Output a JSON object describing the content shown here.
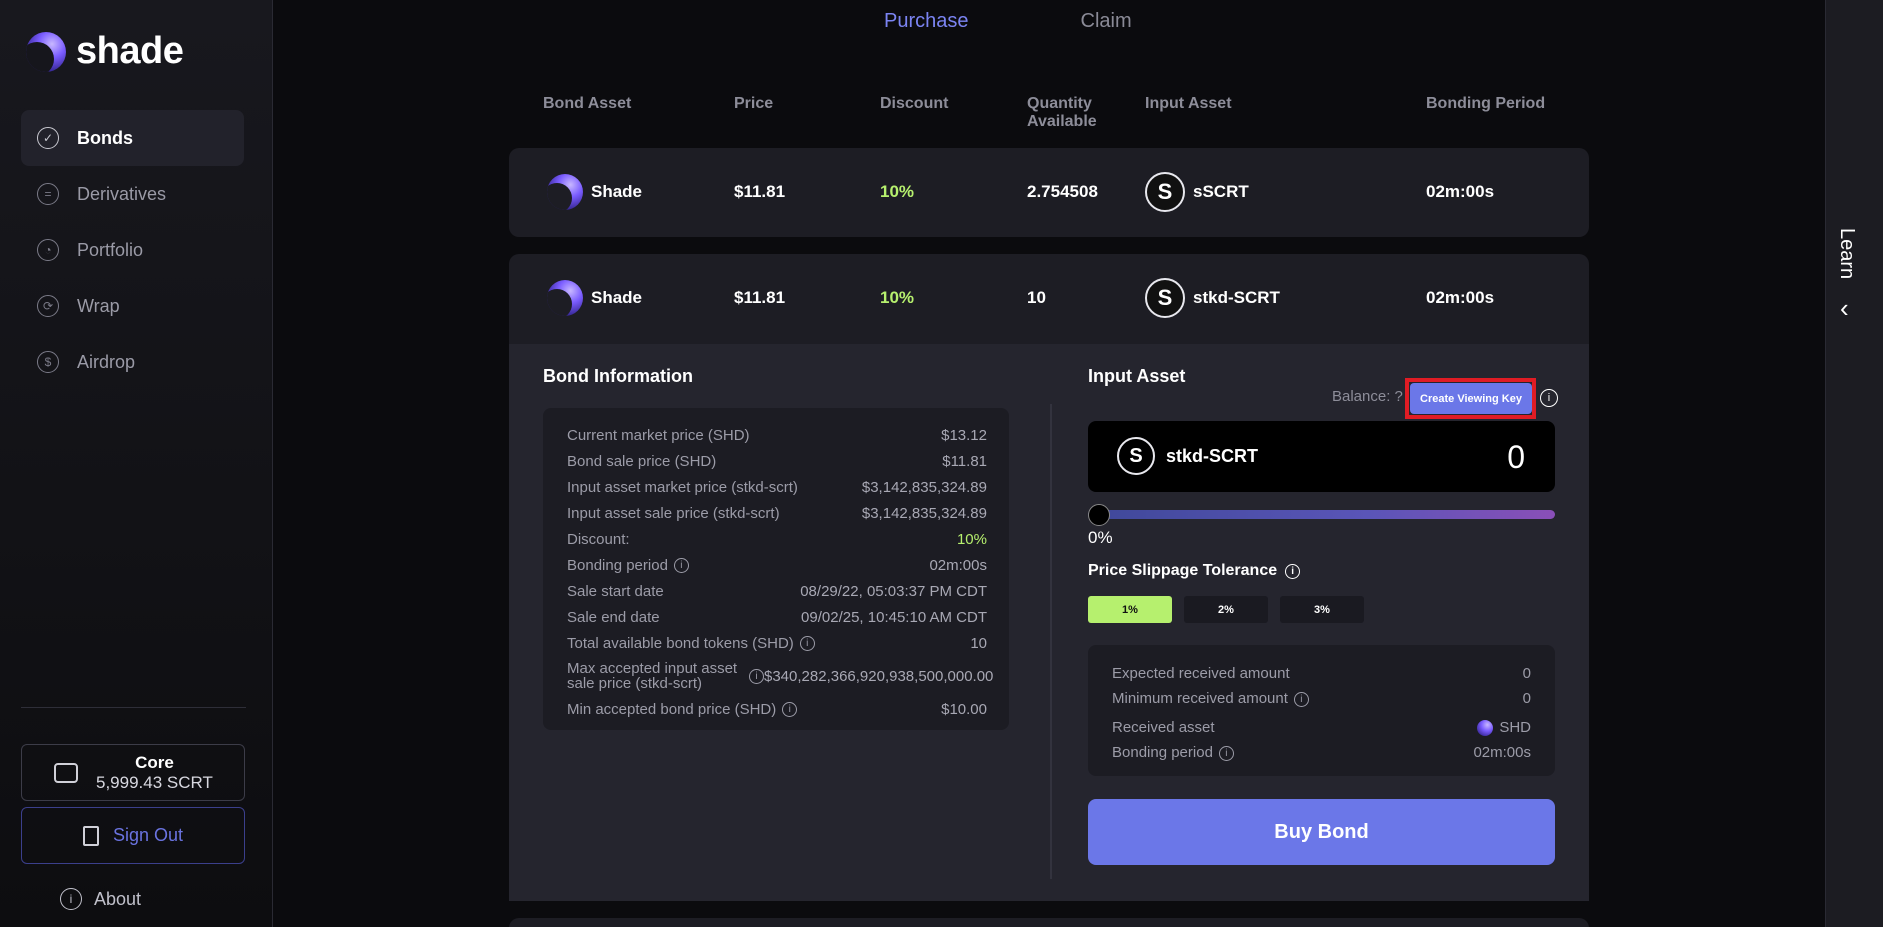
{
  "sidebar": {
    "logo": "shade",
    "nav": [
      {
        "label": "Bonds",
        "icon": "bonds-icon"
      },
      {
        "label": "Derivatives",
        "icon": "derivatives-icon"
      },
      {
        "label": "Portfolio",
        "icon": "portfolio-icon"
      },
      {
        "label": "Wrap",
        "icon": "wrap-icon"
      },
      {
        "label": "Airdrop",
        "icon": "airdrop-icon"
      }
    ],
    "wallet": {
      "title": "Core",
      "balance": "5,999.43 SCRT"
    },
    "sign_out": "Sign Out",
    "about": "About"
  },
  "tabs": {
    "purchase": "Purchase",
    "claim": "Claim"
  },
  "table": {
    "headers": {
      "bond_asset": "Bond Asset",
      "price": "Price",
      "discount": "Discount",
      "quantity_line1": "Quantity",
      "quantity_line2": "Available",
      "input_asset": "Input Asset",
      "bonding_period": "Bonding Period"
    },
    "rows": [
      {
        "bond_asset": "Shade",
        "price": "$11.81",
        "discount": "10%",
        "quantity": "2.754508",
        "input_asset": "sSCRT",
        "bonding_period": "02m:00s"
      },
      {
        "bond_asset": "Shade",
        "price": "$11.81",
        "discount": "10%",
        "quantity": "10",
        "input_asset": "stkd-SCRT",
        "bonding_period": "02m:00s"
      }
    ]
  },
  "bond_info": {
    "title": "Bond Information",
    "rows": [
      {
        "label": "Current market price (SHD)",
        "value": "$13.12"
      },
      {
        "label": "Bond sale price (SHD)",
        "value": "$11.81"
      },
      {
        "label": "Input asset market price (stkd-scrt)",
        "value": "$3,142,835,324.89"
      },
      {
        "label": "Input asset sale price (stkd-scrt)",
        "value": "$3,142,835,324.89"
      },
      {
        "label": "Discount:",
        "value": "10%"
      },
      {
        "label": "Bonding period",
        "value": "02m:00s"
      },
      {
        "label": "Sale start date",
        "value": "08/29/22, 05:03:37 PM CDT"
      },
      {
        "label": "Sale end date",
        "value": "09/02/25, 10:45:10 AM CDT"
      },
      {
        "label": "Total available bond tokens (SHD)",
        "value": "10"
      },
      {
        "label_line1": "Max accepted input asset",
        "label_line2": "sale price (stkd-scrt)",
        "value": "$340,282,366,920,938,500,000.00"
      },
      {
        "label": "Min accepted bond price (SHD)",
        "value": "$10.00"
      }
    ]
  },
  "input_asset": {
    "title": "Input Asset",
    "balance": "Balance: ?",
    "create_viewing_key": "Create Viewing Key",
    "asset": "stkd-SCRT",
    "amount": "0",
    "slider_percent": "0%",
    "slider_value": 0,
    "slippage_title": "Price Slippage Tolerance",
    "slippage_options": [
      "1%",
      "2%",
      "3%"
    ],
    "slippage_selected": "1%",
    "summary": {
      "expected_label": "Expected received amount",
      "expected_value": "0",
      "minimum_label": "Minimum received amount",
      "minimum_value": "0",
      "asset_label": "Received asset",
      "asset_value": "SHD",
      "period_label": "Bonding period",
      "period_value": "02m:00s"
    },
    "buy_button": "Buy Bond"
  },
  "learn": "Learn",
  "colors": {
    "accent": "#6b77e8",
    "green": "#b6f06e",
    "highlight": "#e01c24"
  }
}
